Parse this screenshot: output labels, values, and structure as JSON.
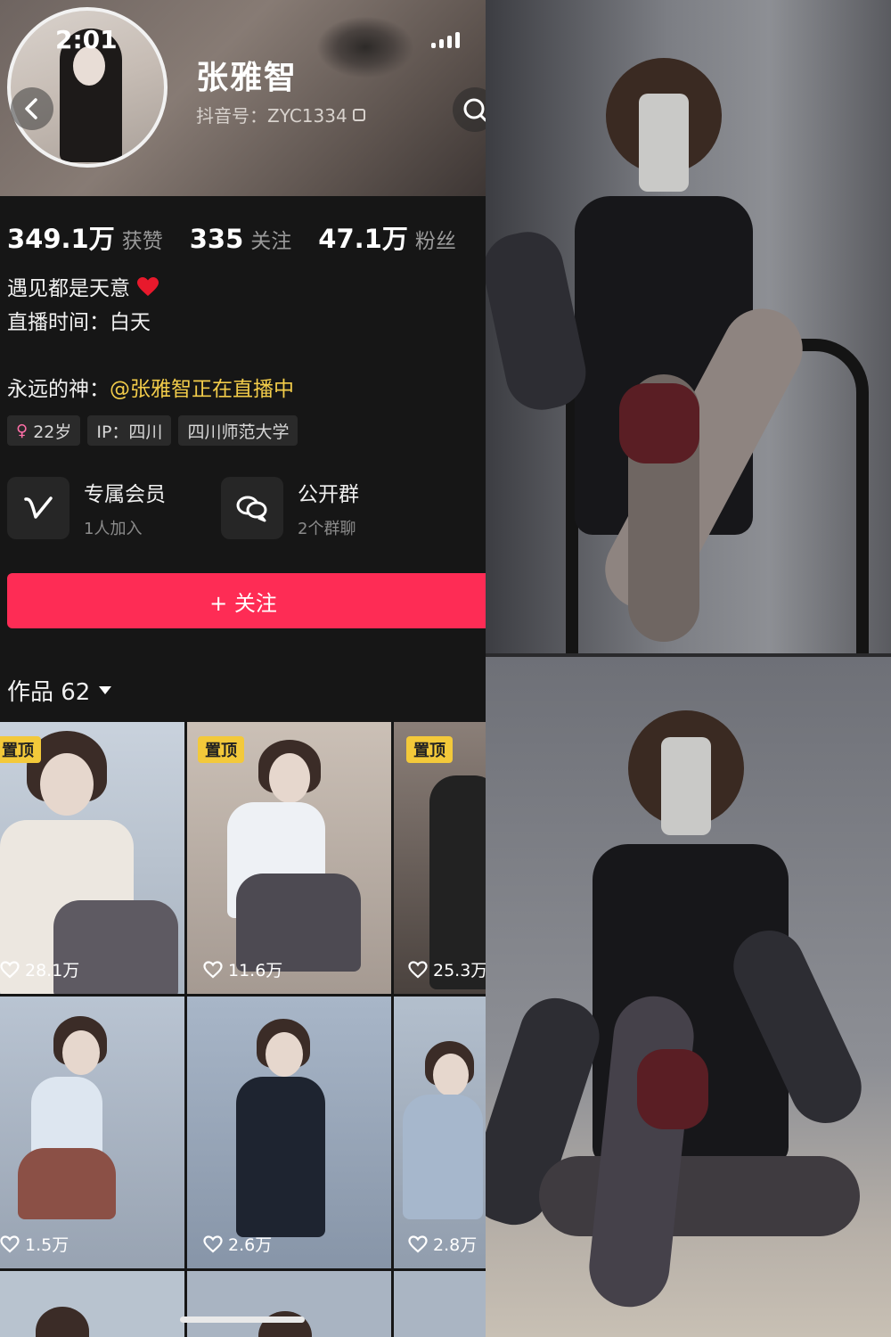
{
  "status_bar": {
    "time": "2:01"
  },
  "profile": {
    "name": "张雅智",
    "douyin_id": "抖音号：ZYC1334",
    "stats": [
      {
        "value": "349.1万",
        "label": "获赞"
      },
      {
        "value": "335",
        "label": "关注"
      },
      {
        "value": "47.1万",
        "label": "粉丝"
      }
    ],
    "bio_line1": "遇见都是天意",
    "bio_line2": "直播时间：白天",
    "god_prefix": "永远的神：",
    "god_mention": "@张雅智正在直播中",
    "tags": {
      "age": "22岁",
      "ip": "IP：四川",
      "school": "四川师范大学"
    }
  },
  "entries": [
    {
      "title": "专属会员",
      "sub": "1人加入",
      "icon": "v-member-icon"
    },
    {
      "title": "公开群",
      "sub": "2个群聊",
      "icon": "group-chat-icon"
    }
  ],
  "follow_button": "+ 关注",
  "works": {
    "title": "作品 62",
    "items": [
      {
        "pinned": true,
        "pin_label": "置顶",
        "likes": "28.1万"
      },
      {
        "pinned": true,
        "pin_label": "置顶",
        "likes": "11.6万"
      },
      {
        "pinned": true,
        "pin_label": "置顶",
        "likes": "25.3万"
      },
      {
        "pinned": false,
        "likes": "1.5万"
      },
      {
        "pinned": false,
        "likes": "2.6万"
      },
      {
        "pinned": false,
        "likes": "2.8万"
      }
    ]
  },
  "colors": {
    "accent": "#fe2c55",
    "mention": "#f2cc4a",
    "pin": "#f3c93a",
    "background": "#161616"
  }
}
